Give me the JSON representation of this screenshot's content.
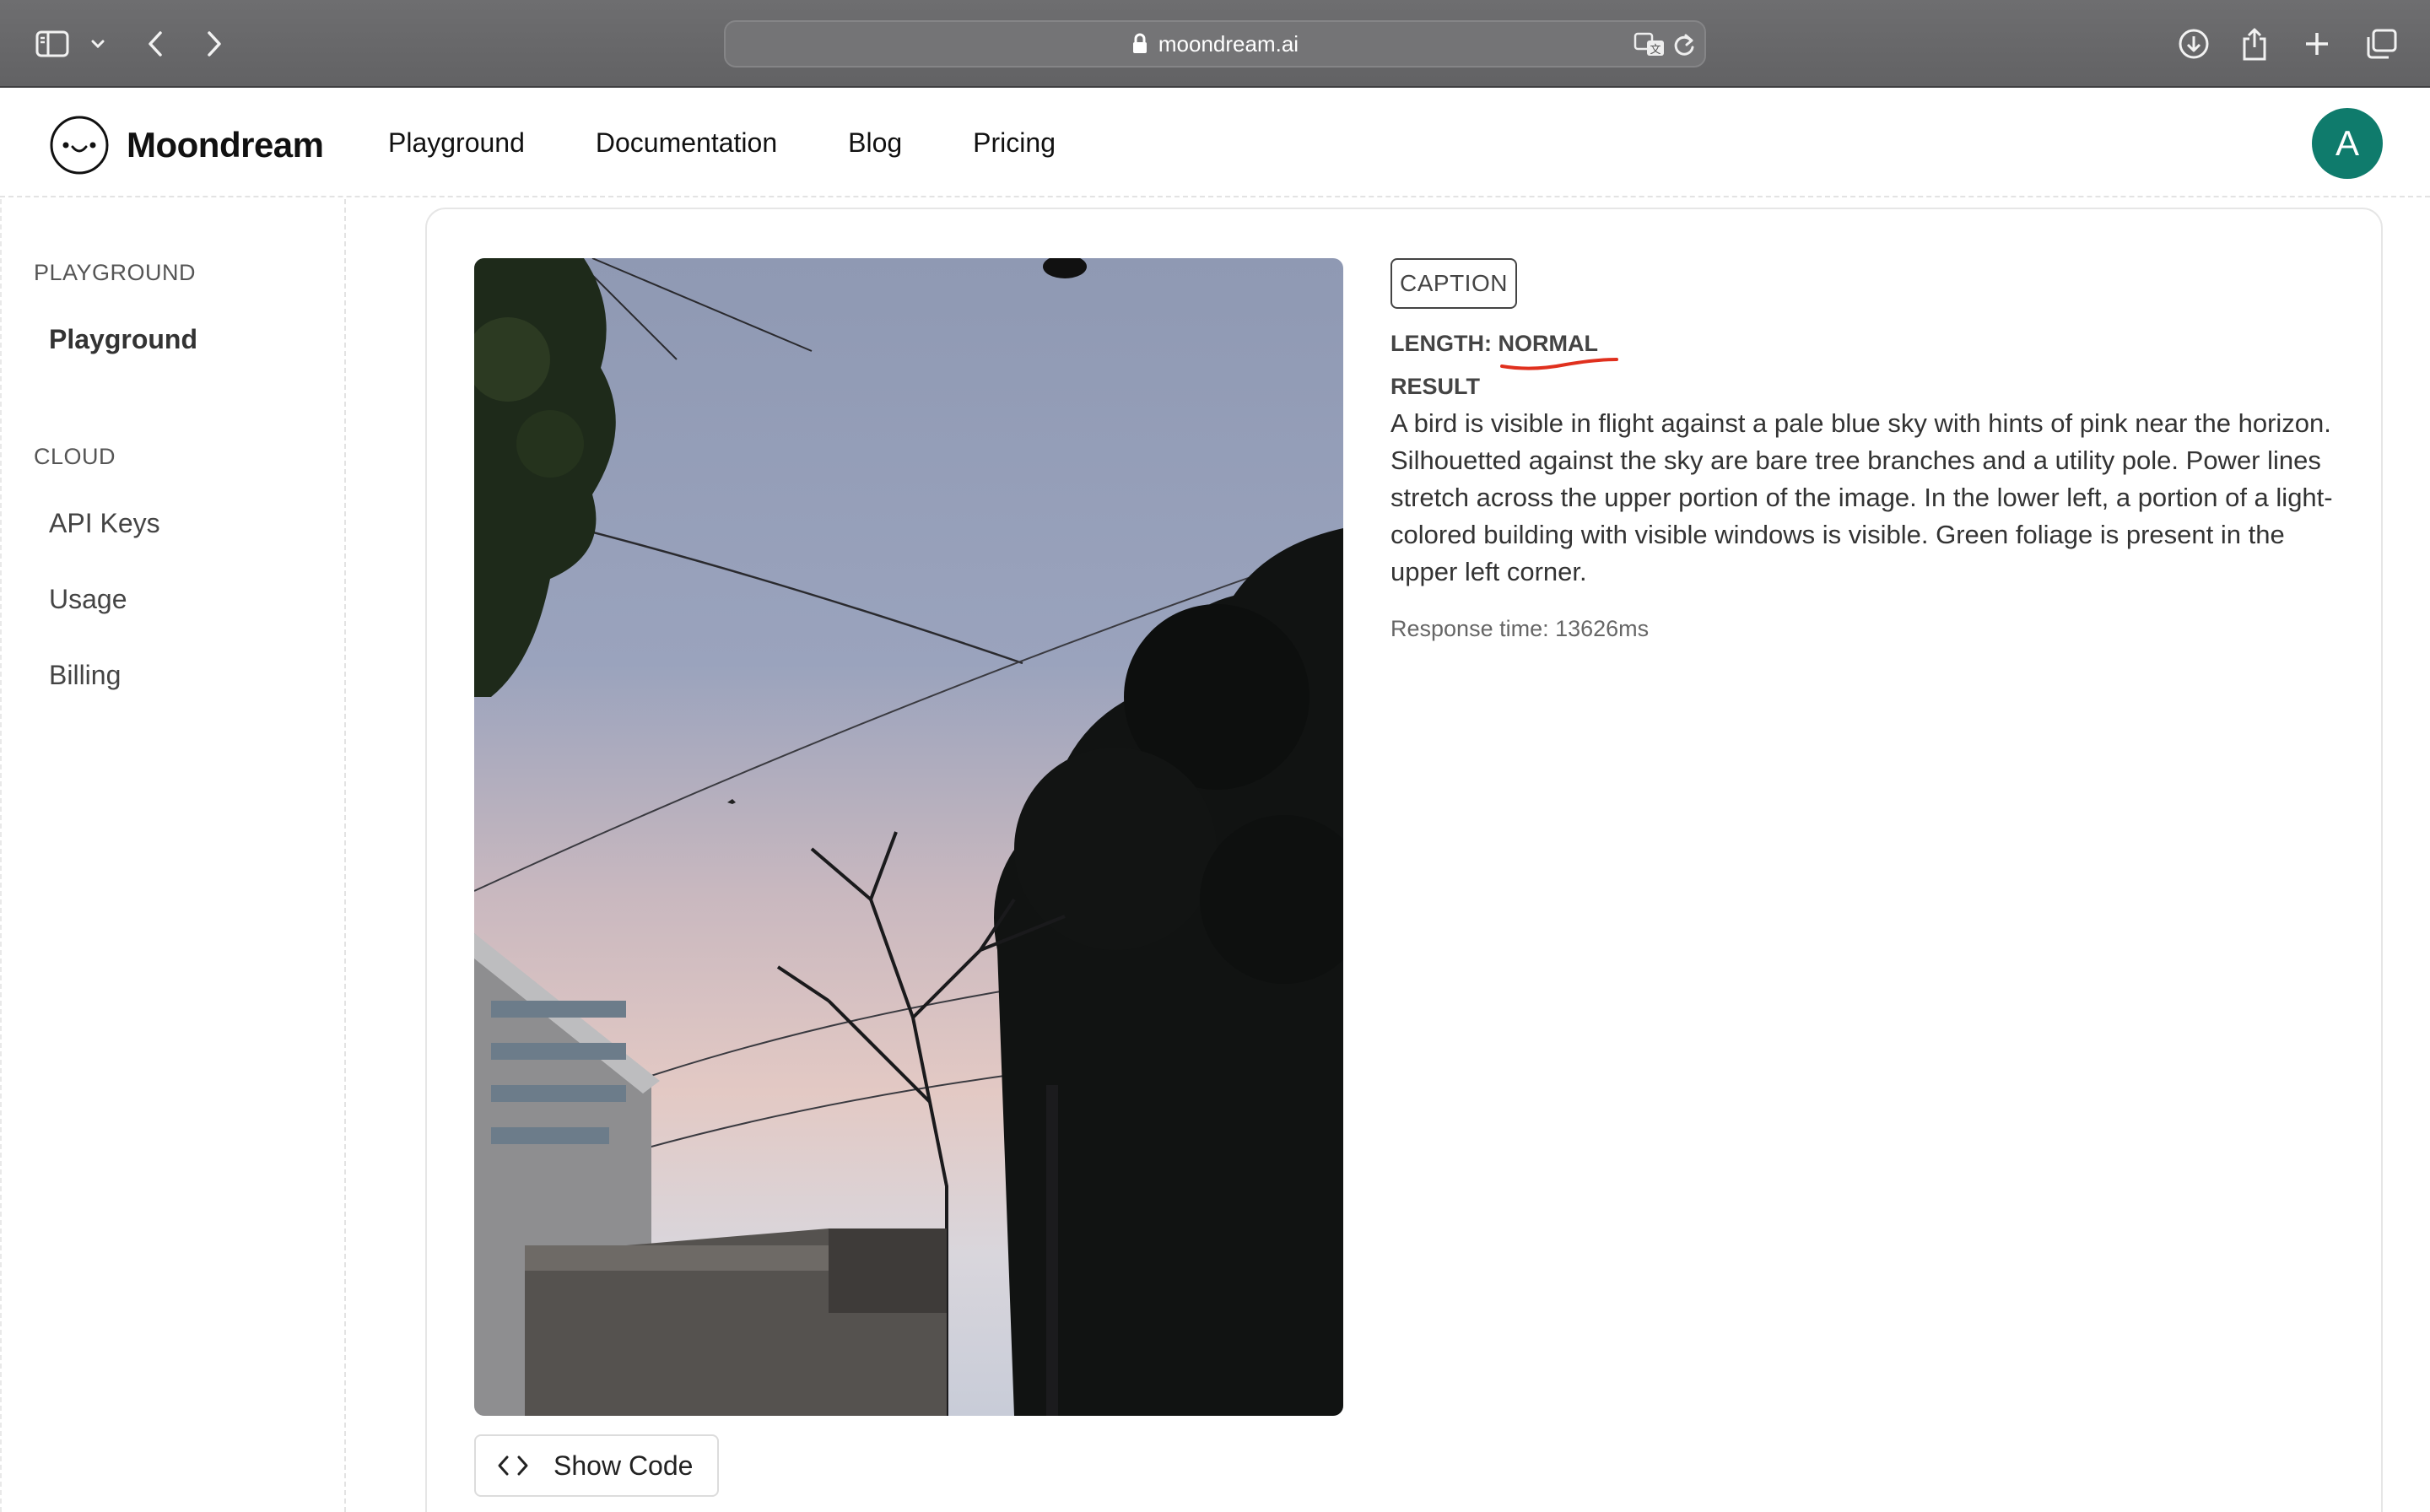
{
  "browser": {
    "url": "moondream.ai",
    "icons": [
      "sidebar-toggle-icon",
      "chevron-down-icon",
      "back-icon",
      "forward-icon",
      "lock-icon",
      "translate-icon",
      "reload-icon",
      "download-icon",
      "share-icon",
      "new-tab-icon",
      "tab-overview-icon"
    ]
  },
  "header": {
    "brand": "Moondream",
    "nav": [
      "Playground",
      "Documentation",
      "Blog",
      "Pricing"
    ],
    "avatar_letter": "A",
    "avatar_color": "#0f7b6c"
  },
  "sidebar": {
    "sections": [
      {
        "title": "PLAYGROUND",
        "items": [
          "Playground"
        ]
      },
      {
        "title": "CLOUD",
        "items": [
          "API Keys",
          "Usage",
          "Billing"
        ]
      }
    ],
    "active_item": "Playground"
  },
  "main": {
    "tag": "CAPTION",
    "length_label": "LENGTH:",
    "length_value": "NORMAL",
    "result_label": "RESULT",
    "result_text": "A bird is visible in flight against a pale blue sky with hints of pink near the horizon. Silhouetted against the sky are bare tree branches and a utility pole. Power lines stretch across the upper portion of the image. In the lower left, a portion of a light-colored building with visible windows is visible. Green foliage is present in the upper left corner.",
    "response_time": "Response time: 13626ms",
    "show_code_label": "Show Code",
    "annotation_color": "#e0301e"
  }
}
